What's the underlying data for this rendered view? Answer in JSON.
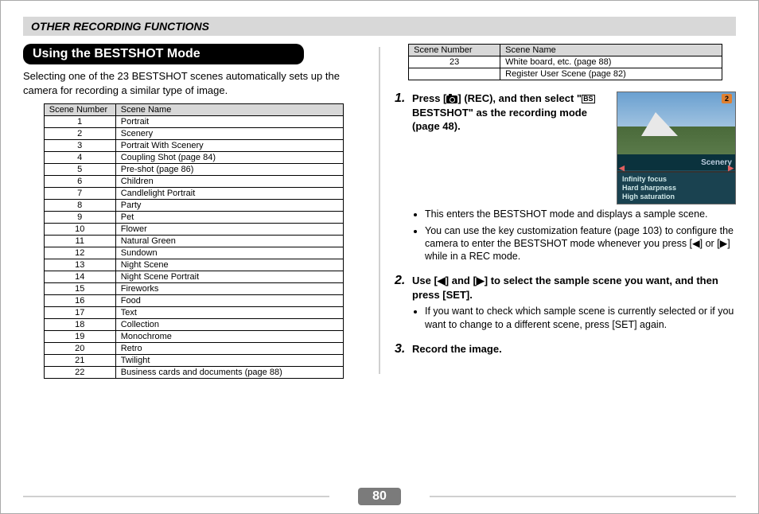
{
  "header": {
    "title": "OTHER RECORDING FUNCTIONS"
  },
  "section": {
    "title": "Using the BESTSHOT Mode",
    "intro": "Selecting one of the 23 BESTSHOT scenes automatically sets up the camera for recording a similar type of image."
  },
  "table_headers": {
    "num": "Scene Number",
    "name": "Scene Name"
  },
  "scenes_left": [
    {
      "num": "1",
      "name": "Portrait"
    },
    {
      "num": "2",
      "name": "Scenery"
    },
    {
      "num": "3",
      "name": "Portrait With Scenery"
    },
    {
      "num": "4",
      "name": "Coupling Shot (page 84)"
    },
    {
      "num": "5",
      "name": "Pre-shot (page 86)"
    },
    {
      "num": "6",
      "name": "Children"
    },
    {
      "num": "7",
      "name": "Candlelight Portrait"
    },
    {
      "num": "8",
      "name": "Party"
    },
    {
      "num": "9",
      "name": "Pet"
    },
    {
      "num": "10",
      "name": "Flower"
    },
    {
      "num": "11",
      "name": "Natural Green"
    },
    {
      "num": "12",
      "name": "Sundown"
    },
    {
      "num": "13",
      "name": "Night Scene"
    },
    {
      "num": "14",
      "name": "Night Scene Portrait"
    },
    {
      "num": "15",
      "name": "Fireworks"
    },
    {
      "num": "16",
      "name": "Food"
    },
    {
      "num": "17",
      "name": "Text"
    },
    {
      "num": "18",
      "name": "Collection"
    },
    {
      "num": "19",
      "name": "Monochrome"
    },
    {
      "num": "20",
      "name": "Retro"
    },
    {
      "num": "21",
      "name": "Twilight"
    },
    {
      "num": "22",
      "name": "Business cards and documents (page 88)"
    }
  ],
  "scenes_right": [
    {
      "num": "23",
      "name": "White board, etc. (page 88)"
    },
    {
      "num": "",
      "name": "Register User Scene (page 82)"
    }
  ],
  "steps": {
    "s1": {
      "num": "1.",
      "title_before": "Press [",
      "title_mid1": "] (REC), and then select \"",
      "title_mid2": " BESTSHOT\" as the recording mode (page 48).",
      "bullets": [
        "This enters the BESTSHOT mode and displays a sample scene.",
        "You can use the key customization feature (page 103) to configure the camera to enter the BESTSHOT mode whenever you press [◀] or [▶] while in a REC mode."
      ]
    },
    "s2": {
      "num": "2.",
      "title": "Use [◀] and [▶] to select the sample scene you want, and then press [SET].",
      "bullets": [
        "If you want to check which sample scene is currently selected or if you want to change to a different scene, press [SET] again."
      ]
    },
    "s3": {
      "num": "3.",
      "title": "Record the image."
    }
  },
  "screenshot": {
    "scene_number": "2",
    "scene_label": "Scenery",
    "line1": "Infinity focus",
    "line2": "Hard sharpness",
    "line3": "High saturation"
  },
  "icon_bs_text": "BS",
  "page_number": "80"
}
